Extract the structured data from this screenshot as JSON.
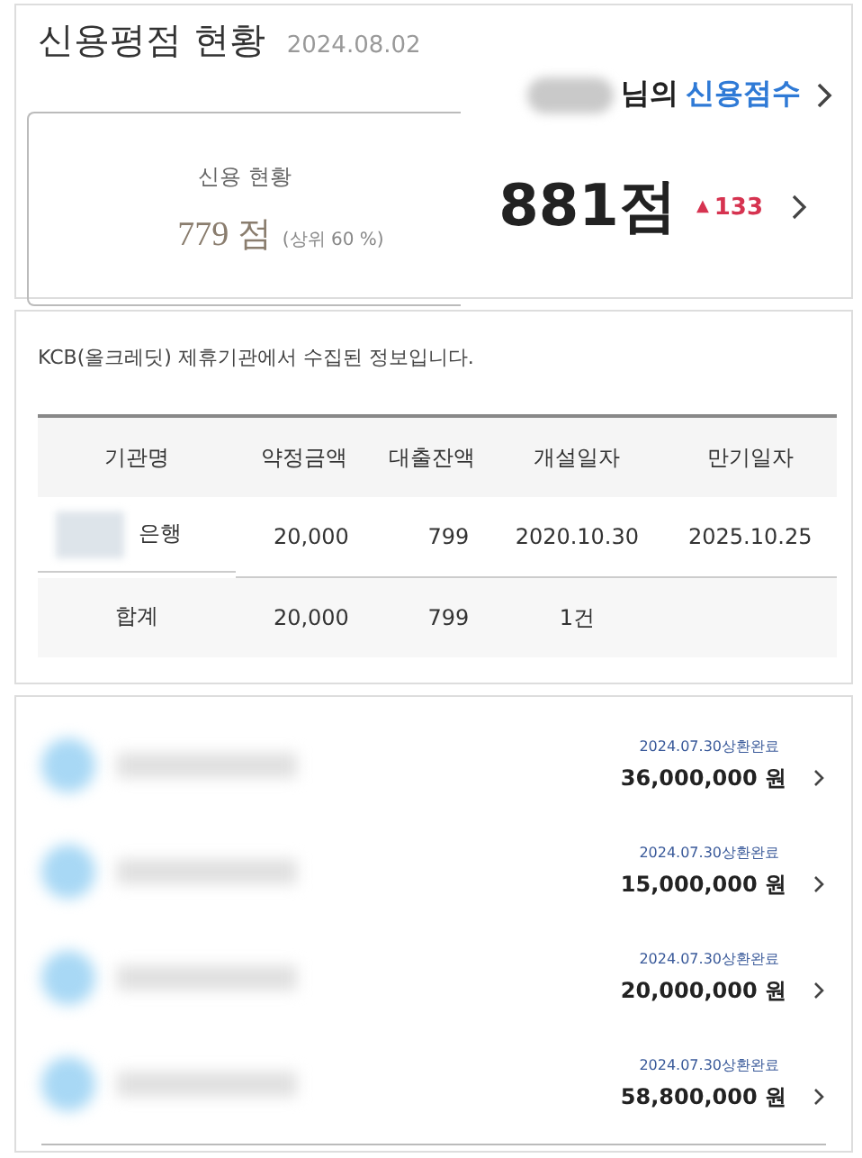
{
  "header": {
    "title": "신용평점 현황",
    "date": "2024.08.02"
  },
  "summary": {
    "label": "신용 현황",
    "score": "779 점",
    "rank": "(상위 60 %)"
  },
  "score_panel": {
    "name_suffix": "님의",
    "link": "신용점수",
    "score": "881점",
    "change_arrow": "▲",
    "change": "133"
  },
  "loans": {
    "note": "KCB(올크레딧) 제휴기관에서 수집된 정보입니다.",
    "columns": [
      "기관명",
      "약정금액",
      "대출잔액",
      "개설일자",
      "만기일자"
    ],
    "rows": [
      {
        "cells": [
          "은행",
          "20,000",
          "799",
          "2020.10.30",
          "2025.10.25"
        ]
      }
    ],
    "total": [
      "합계",
      "20,000",
      "799",
      "1건"
    ]
  },
  "repayments": [
    {
      "status": "2024.07.30상환완료",
      "amount": "36,000,000 원"
    },
    {
      "status": "2024.07.30상환완료",
      "amount": "15,000,000 원"
    },
    {
      "status": "2024.07.30상환완료",
      "amount": "20,000,000 원"
    },
    {
      "status": "2024.07.30상환완료",
      "amount": "58,800,000 원"
    }
  ]
}
